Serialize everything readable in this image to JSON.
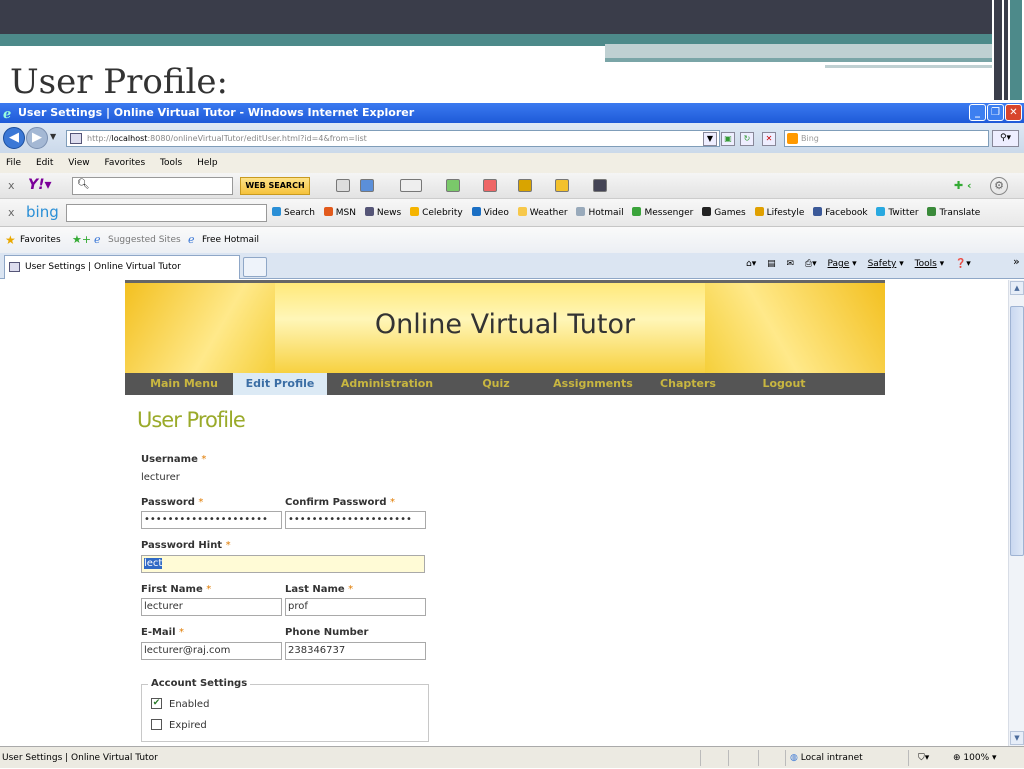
{
  "slide": {
    "title": "User Profile:"
  },
  "window": {
    "title": "User Settings | Online Virtual Tutor - Windows Internet Explorer"
  },
  "address": {
    "url_prefix": "http://",
    "url_host": "localhost",
    "url_rest": ":8080/onlineVirtualTutor/editUser.html?id=4&from=list",
    "search_placeholder": "Bing"
  },
  "menu": [
    "File",
    "Edit",
    "View",
    "Favorites",
    "Tools",
    "Help"
  ],
  "yahoo": {
    "web_search": "WEB SEARCH"
  },
  "bing": {
    "links": [
      "Search",
      "MSN",
      "News",
      "Celebrity",
      "Video",
      "Weather",
      "Hotmail",
      "Messenger",
      "Games",
      "Lifestyle",
      "Facebook",
      "Twitter",
      "Translate"
    ]
  },
  "favorites": {
    "label": "Favorites",
    "suggested": "Suggested Sites",
    "hotmail": "Free Hotmail"
  },
  "tab": {
    "title": "User Settings | Online Virtual Tutor"
  },
  "command": {
    "page": "Page",
    "safety": "Safety",
    "tools": "Tools"
  },
  "site": {
    "title": "Online Virtual Tutor",
    "nav": [
      "Main Menu",
      "Edit Profile",
      "Administration",
      "Quiz",
      "Assignments",
      "Chapters",
      "Logout"
    ]
  },
  "form": {
    "heading": "User Profile",
    "username_label": "Username",
    "username_value": "lecturer",
    "password_label": "Password",
    "password_value": "•••••••••••••••••••••",
    "confirm_label": "Confirm Password",
    "confirm_value": "•••••••••••••••••••••",
    "hint_label": "Password Hint",
    "hint_value": "lect",
    "first_label": "First Name",
    "first_value": "lecturer",
    "last_label": "Last Name",
    "last_value": "prof",
    "email_label": "E-Mail",
    "email_value": "lecturer@raj.com",
    "phone_label": "Phone Number",
    "phone_value": "238346737",
    "required_mark": "*",
    "account_legend": "Account Settings",
    "enabled_label": "Enabled",
    "expired_label": "Expired"
  },
  "status": {
    "text": "User Settings | Online Virtual Tutor",
    "zone": "Local intranet",
    "zoom": "100%"
  }
}
